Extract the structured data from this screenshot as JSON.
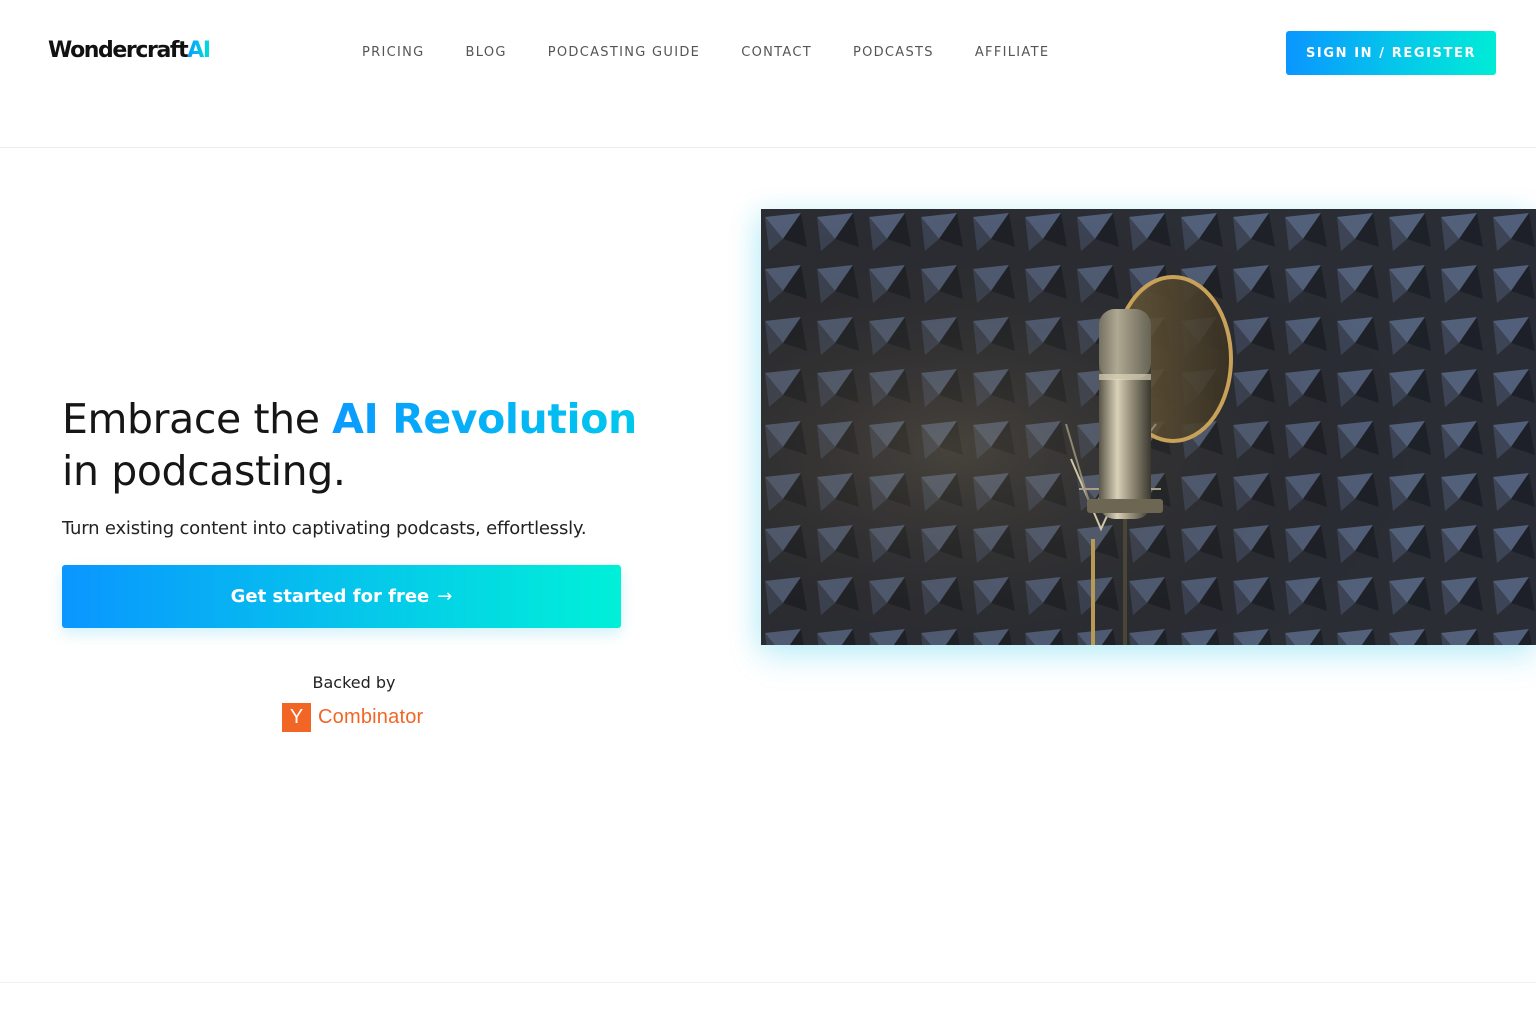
{
  "header": {
    "logo_text": "Wondercraft",
    "logo_accent": "AI",
    "nav": [
      {
        "id": "pricing",
        "label": "PRICING"
      },
      {
        "id": "blog",
        "label": "BLOG"
      },
      {
        "id": "podcasting-guide",
        "label": "PODCASTING GUIDE"
      },
      {
        "id": "contact",
        "label": "CONTACT"
      },
      {
        "id": "podcasts",
        "label": "PODCASTS"
      },
      {
        "id": "affiliate",
        "label": "AFFILIATE"
      }
    ],
    "signin_label": "SIGN IN / REGISTER"
  },
  "hero": {
    "title_prefix": "Embrace the ",
    "title_accent": "AI Revolution",
    "title_suffix": "in podcasting.",
    "subtitle": "Turn existing content into captivating podcasts, effortlessly.",
    "cta_label": "Get started for free",
    "cta_arrow": "→",
    "backed_by": "Backed by",
    "backer_mark": "Y",
    "backer_name": "Combinator"
  },
  "colors": {
    "accent_blue": "#0a9bff",
    "accent_teal": "#00ecd6",
    "yc_orange": "#f26625"
  },
  "icons": {
    "cta_arrow": "arrow-right-icon",
    "studio_image": "microphone-studio-image"
  }
}
